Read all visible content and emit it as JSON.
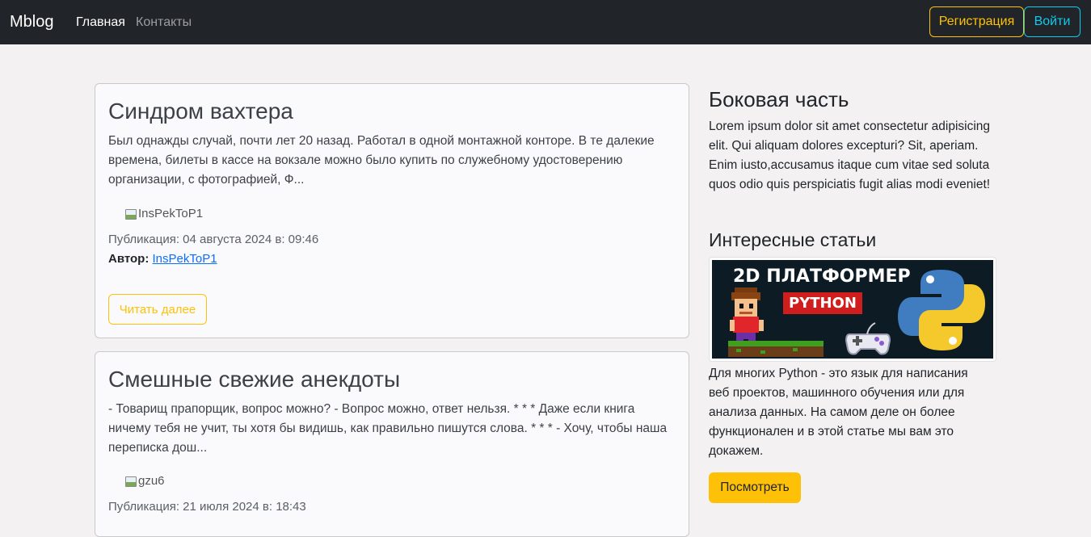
{
  "navbar": {
    "brand": "Mblog",
    "links": [
      {
        "label": "Главная"
      },
      {
        "label": "Контакты"
      }
    ],
    "register_label": "Регистрация",
    "login_label": "Войти",
    "colors": {
      "register": "#ffc107",
      "login": "#0dcaf0",
      "background": "#212529"
    }
  },
  "posts": [
    {
      "title": "Синдром вахтера",
      "excerpt": "Был однажды случай, почти лет 20 назад. Работал в одной монтажной конторе. В те далекие времена, билеты в кассе на вокзале можно было купить по служебному удостоверению организации, с фотографией, Ф...",
      "author_image_alt": "InsPekToP1",
      "published": "Публикация: 04 августа 2024 в: 09:46",
      "author_label": "Автор:",
      "author_name": "InsPekToP1",
      "read_more_label": "Читать далее"
    },
    {
      "title": "Смешные свежие анекдоты",
      "excerpt": "- Товарищ прапорщик, вопрос можно? - Вопрос можно, ответ нельзя. * * * Даже если книга ничему тебя не учит, ты хотя бы видишь, как правильно пишутся слова. * * * - Хочу, чтобы наша переписка дош...",
      "author_image_alt": "gzu6",
      "published": "Публикация: 21 июля 2024 в: 18:43"
    }
  ],
  "sidebar": {
    "title": "Боковая часть",
    "text": "Lorem ipsum dolor sit amet consectetur adipisicing elit. Qui aliquam dolores excepturi? Sit, aperiam. Enim iusto,accusamus itaque cum vitae sed soluta quos odio quis perspiciatis fugit alias modi eveniet!",
    "featured_title": "Интересные статьи",
    "thumbnail": {
      "headline": "2D ПЛАТФОРМЕР",
      "badge": "PYTHON",
      "icons": [
        "pixel-character-icon",
        "gamepad-icon",
        "python-logo-icon"
      ]
    },
    "featured_text": "Для многих Python - это язык для написания веб проектов, машинного обучения или для анализа данных. На самом деле он более функционален и в этой статье мы вам это докажем.",
    "view_label": "Посмотреть",
    "accent_color": "#ffc107"
  }
}
